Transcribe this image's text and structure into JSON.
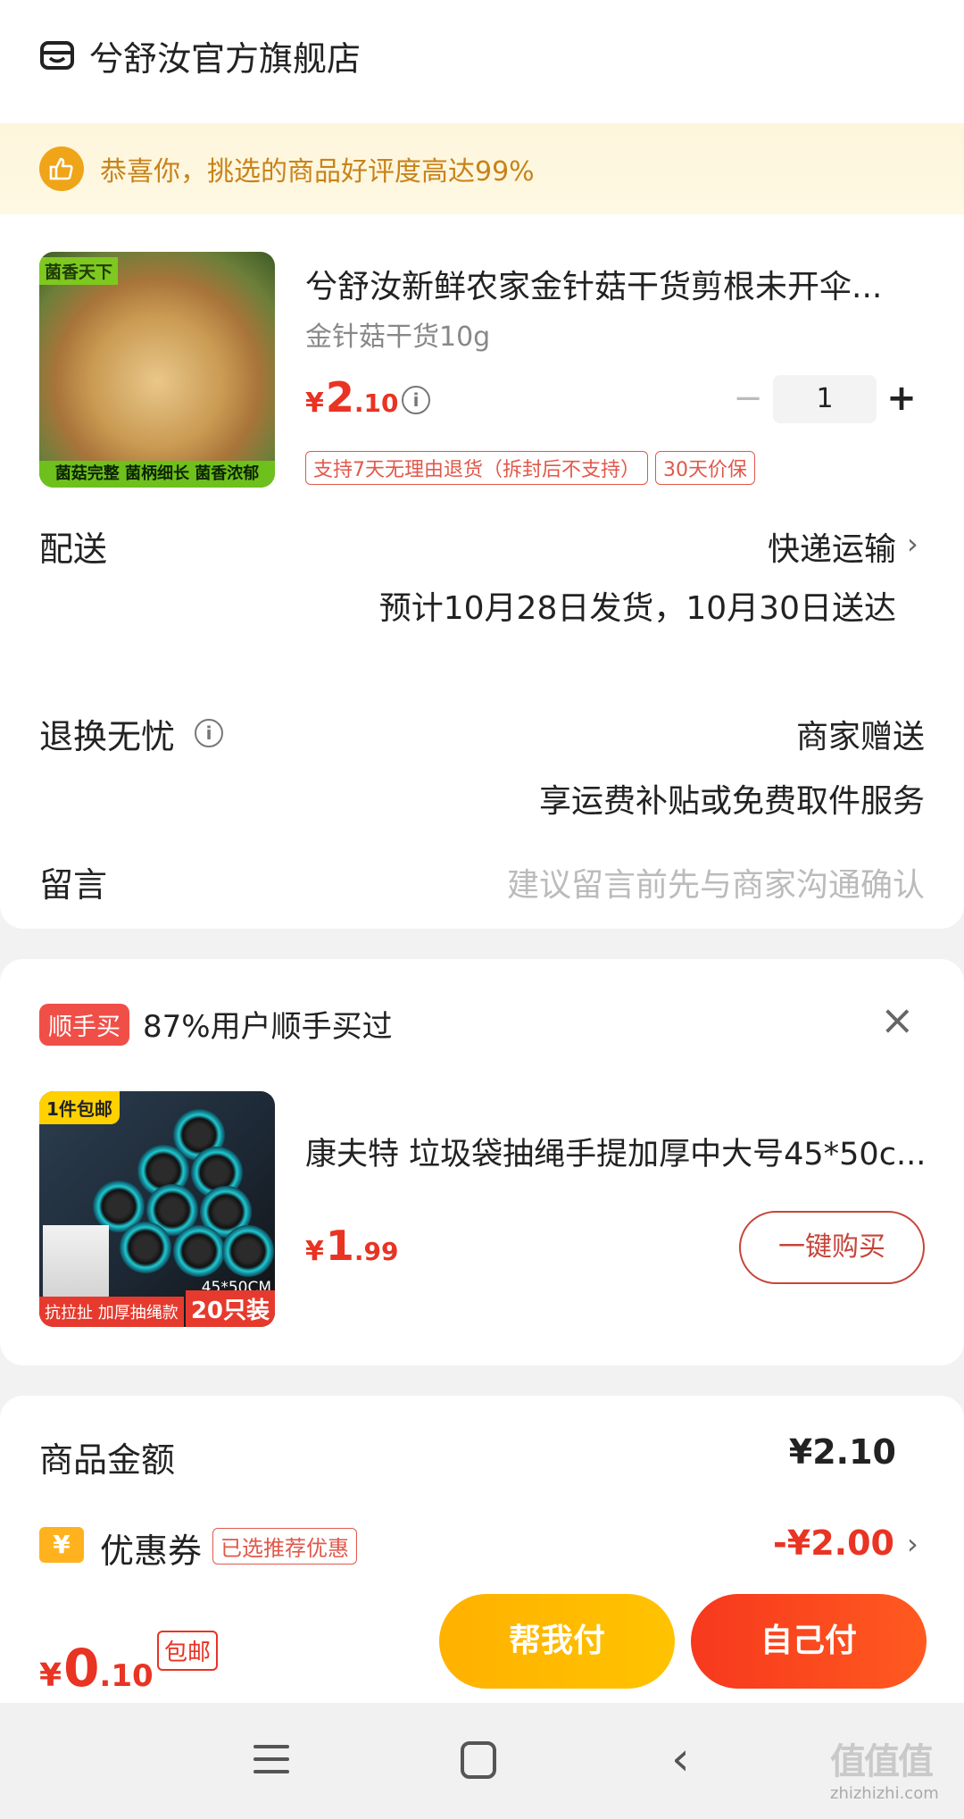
{
  "store": {
    "name": "兮舒汝官方旗舰店",
    "icon": "store-icon"
  },
  "banner": {
    "text": "恭喜你，挑选的商品好评度高达99%",
    "icon": "thumbs-up-icon"
  },
  "product": {
    "title": "兮舒汝新鲜农家金针菇干货剪根未开伞...",
    "spec": "金针菇干货10g",
    "price_symbol": "¥",
    "price_int": "2",
    "price_dec": ".10",
    "quantity": "1",
    "minus": "−",
    "plus": "+",
    "badges": [
      "支持7天无理由退货（拆封后不支持）",
      "30天价保"
    ],
    "image_tag_top": "菌香天下",
    "image_tag_bottom": "菌菇完整 菌柄细长 菌香浓郁"
  },
  "delivery": {
    "label": "配送",
    "method": "快递运输",
    "estimate": "预计10月28日发货，10月30日送达"
  },
  "returns": {
    "label": "退换无忧",
    "value": "商家赠送",
    "sub": "享运费补贴或免费取件服务"
  },
  "message": {
    "label": "留言",
    "placeholder": "建议留言前先与商家沟通确认"
  },
  "addon": {
    "badge": "顺手买",
    "headline": "87%用户顺手买过",
    "close": "×",
    "title": "康夫特 垃圾袋抽绳手提加厚中大号45*50c...",
    "price_symbol": "¥",
    "price_int": "1",
    "price_dec": ".99",
    "buy_label": "一键购买",
    "image_tag_top": "1件包邮",
    "image_tag_bl": "抗拉扯 加厚抽绳款",
    "image_tag_br": "20只装",
    "image_tag_size": "45*50CM"
  },
  "summary": {
    "goods_label": "商品金额",
    "goods_value": "¥2.10",
    "coupon_label": "优惠券",
    "coupon_icon_text": "¥",
    "coupon_tag": "已选推荐优惠",
    "coupon_value": "-¥2.00"
  },
  "bottom": {
    "price_symbol": "¥",
    "price_int": "0",
    "price_dec": ".10",
    "free_ship": "包邮",
    "help_pay": "帮我付",
    "self_pay": "自己付"
  },
  "watermark": {
    "main": "值值值",
    "sub": "zhizhizhi.com"
  },
  "colors": {
    "accent": "#e93323",
    "gold": "#c8831a",
    "help": "#ffb100",
    "self": "#f7381e"
  }
}
